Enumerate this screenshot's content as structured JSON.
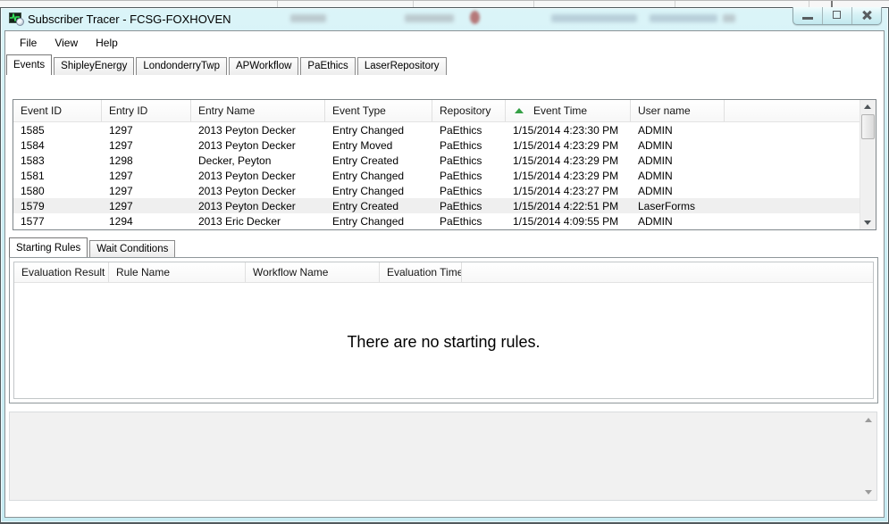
{
  "window": {
    "title": "Subscriber Tracer - FCSG-FOXHOVEN",
    "controls": [
      "minimize-icon",
      "maximize-icon",
      "close-icon"
    ]
  },
  "menu": {
    "items": [
      "File",
      "View",
      "Help"
    ]
  },
  "repository_tabs": {
    "selected": "Events",
    "items": [
      "Events",
      "ShipleyEnergy",
      "LondonderryTwp",
      "APWorkflow",
      "PaEthics",
      "LaserRepository"
    ]
  },
  "events_table": {
    "columns": [
      "Event ID",
      "Entry ID",
      "Entry Name",
      "Event Type",
      "Repository",
      "Event Time",
      "User name"
    ],
    "sort_column": "Event Time",
    "sort_direction": "ascending",
    "selected_row_index": 5,
    "rows": [
      [
        "1585",
        "1297",
        "2013 Peyton Decker",
        "Entry Changed",
        "PaEthics",
        "1/15/2014 4:23:30 PM",
        "ADMIN"
      ],
      [
        "1584",
        "1297",
        "2013 Peyton Decker",
        "Entry Moved",
        "PaEthics",
        "1/15/2014 4:23:29 PM",
        "ADMIN"
      ],
      [
        "1583",
        "1298",
        "Decker, Peyton",
        "Entry Created",
        "PaEthics",
        "1/15/2014 4:23:29 PM",
        "ADMIN"
      ],
      [
        "1581",
        "1297",
        "2013 Peyton Decker",
        "Entry Changed",
        "PaEthics",
        "1/15/2014 4:23:29 PM",
        "ADMIN"
      ],
      [
        "1580",
        "1297",
        "2013 Peyton Decker",
        "Entry Changed",
        "PaEthics",
        "1/15/2014 4:23:27 PM",
        "ADMIN"
      ],
      [
        "1579",
        "1297",
        "2013 Peyton Decker",
        "Entry Created",
        "PaEthics",
        "1/15/2014 4:22:51 PM",
        "LaserForms"
      ],
      [
        "1577",
        "1294",
        "2013 Eric Decker",
        "Entry Changed",
        "PaEthics",
        "1/15/2014 4:09:55 PM",
        "ADMIN"
      ]
    ]
  },
  "rules_tabs": {
    "selected": "Starting Rules",
    "items": [
      "Starting Rules",
      "Wait Conditions"
    ]
  },
  "rules_table": {
    "columns": [
      "Evaluation Result",
      "Rule Name",
      "Workflow Name",
      "Evaluation Time"
    ],
    "rows": [],
    "empty_message": "There are no starting rules."
  },
  "colors": {
    "titlebar_glass": "#cdeff4",
    "window_border": "#525a5d",
    "sort_arrow_green": "#35a046",
    "selected_row": "#efefef",
    "detail_panel": "#f1f1f1"
  }
}
